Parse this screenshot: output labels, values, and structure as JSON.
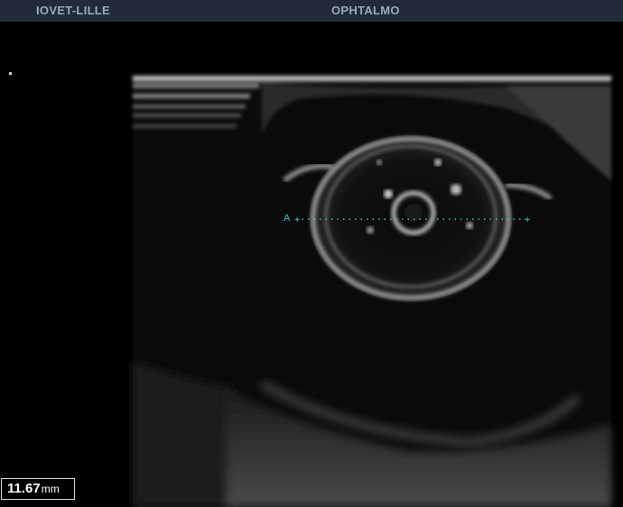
{
  "header": {
    "site_label": "IOVET-LILLE",
    "exam_label": "OPHTALMO"
  },
  "measurement": {
    "caliper_label": "A",
    "value": "11.67",
    "unit": "mm"
  },
  "colors": {
    "header_bg": "#1f2c38",
    "header_text": "#9aa9b6",
    "caliper": "#3cc6c0",
    "background": "#000000"
  }
}
